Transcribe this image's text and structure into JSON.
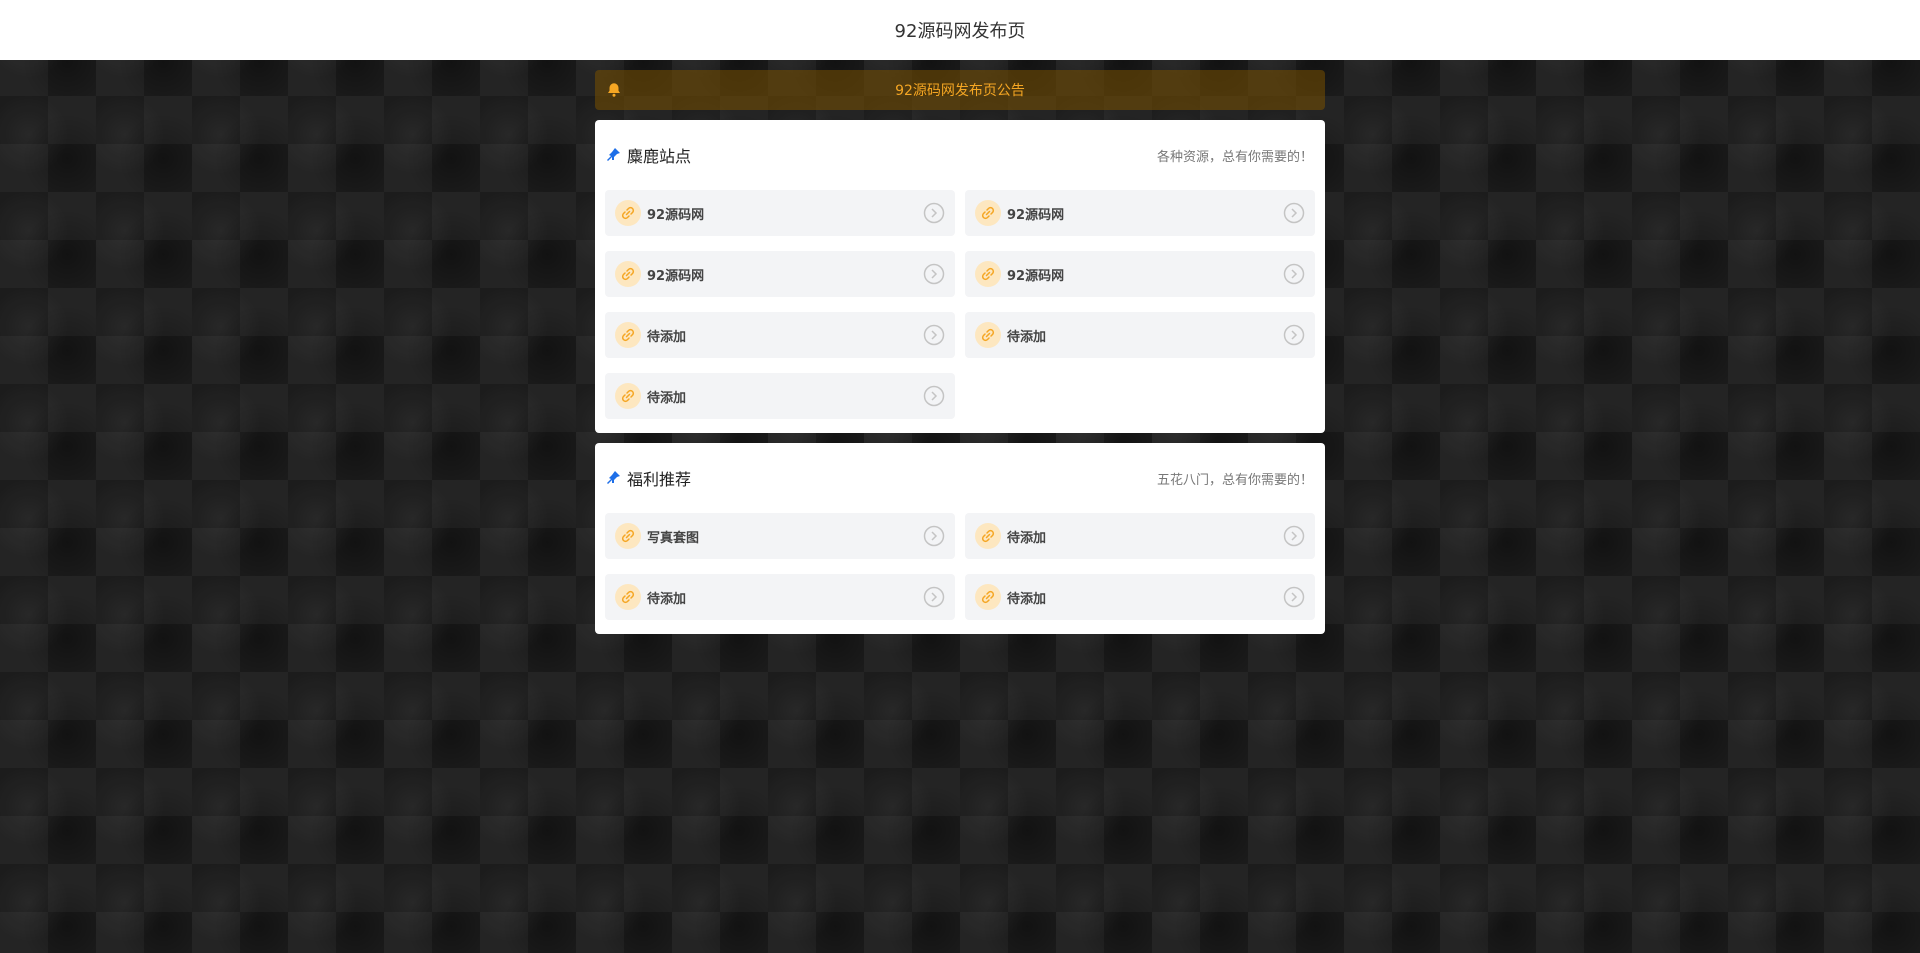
{
  "header": {
    "title": "92源码网发布页"
  },
  "notice": {
    "text": "92源码网发布页公告",
    "icon": "bell-icon",
    "color": "#f5a623"
  },
  "sections": [
    {
      "title": "麋鹿站点",
      "subtitle": "各种资源，总有你需要的！",
      "items": [
        "92源码网",
        "92源码网",
        "92源码网",
        "92源码网",
        "待添加",
        "待添加",
        "待添加"
      ]
    },
    {
      "title": "福利推荐",
      "subtitle": "五花八门，总有你需要的！",
      "items": [
        "写真套图",
        "待添加",
        "待添加",
        "待添加"
      ]
    }
  ]
}
